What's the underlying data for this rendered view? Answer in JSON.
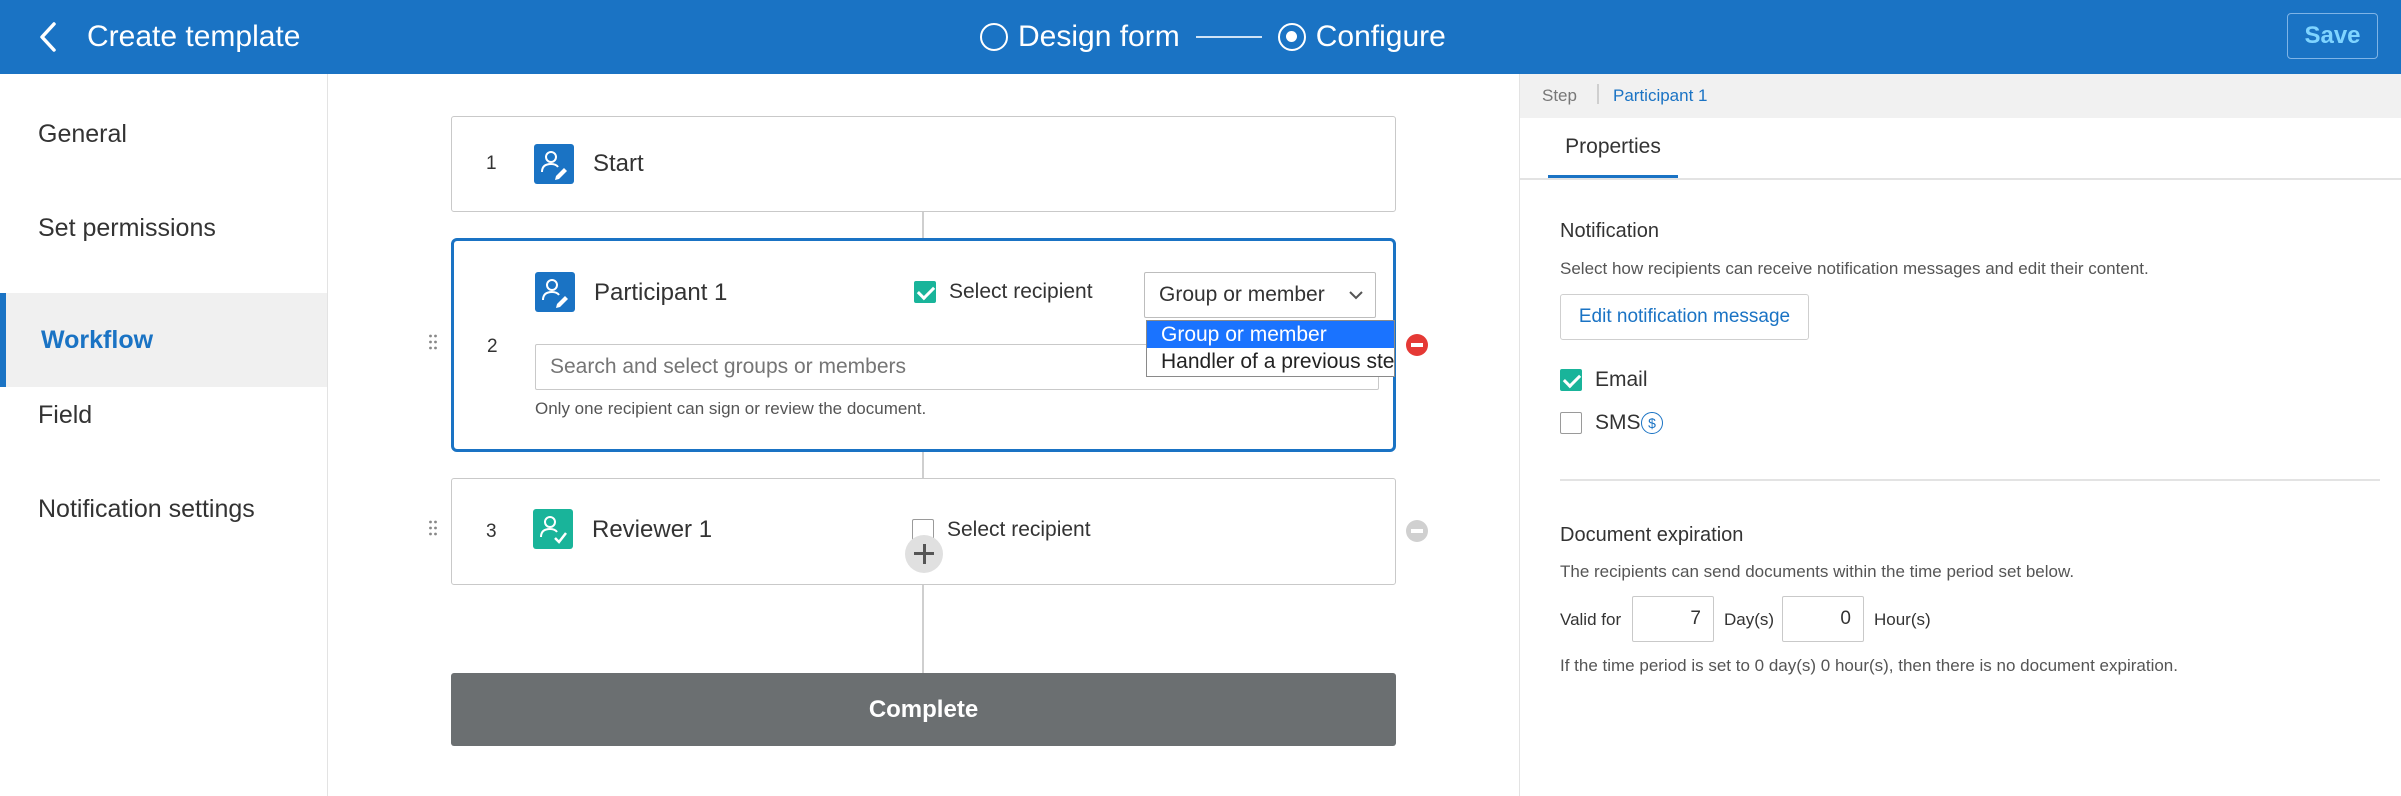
{
  "header": {
    "title": "Create template",
    "steps": [
      {
        "label": "Design form",
        "active": false
      },
      {
        "label": "Configure",
        "active": true
      }
    ],
    "save_label": "Save"
  },
  "sidebar": {
    "items": [
      {
        "label": "General",
        "active": false
      },
      {
        "label": "Set permissions",
        "active": false
      },
      {
        "label": "Workflow",
        "active": true
      },
      {
        "label": "Field",
        "active": false
      },
      {
        "label": "Notification settings",
        "active": false
      }
    ]
  },
  "workflow": {
    "steps": [
      {
        "number": "1",
        "name": "Start",
        "icon": "user-edit-icon"
      },
      {
        "number": "2",
        "name": "Participant 1",
        "icon": "user-edit-icon",
        "select_recipient_label": "Select recipient",
        "select_recipient_checked": true,
        "recipient_type": "Group or member",
        "search_placeholder": "Search and select groups or members",
        "help": "Only one recipient can sign or review the document."
      },
      {
        "number": "3",
        "name": "Reviewer 1",
        "icon": "user-check-icon",
        "select_recipient_label": "Select recipient",
        "select_recipient_checked": false
      }
    ],
    "dropdown_options": [
      "Group or member",
      "Handler of a previous step"
    ],
    "complete_label": "Complete",
    "colors": {
      "accent": "#1a73c4",
      "teal": "#19b49a",
      "remove": "#e53935"
    }
  },
  "panel": {
    "breadcrumb_step": "Step",
    "breadcrumb_current": "Participant 1",
    "tab": "Properties",
    "notification": {
      "heading": "Notification",
      "description": "Select how recipients can receive notification messages and edit their content.",
      "edit_button": "Edit notification message",
      "email_label": "Email",
      "email_checked": true,
      "sms_label": "SMS",
      "sms_checked": false
    },
    "expiration": {
      "heading": "Document expiration",
      "description": "The recipients can send documents within the time period set below.",
      "valid_for_label": "Valid for",
      "days_value": "7",
      "days_unit": "Day(s)",
      "hours_value": "0",
      "hours_unit": "Hour(s)",
      "note": "If the time period is set to 0 day(s) 0 hour(s), then there is no document expiration."
    }
  }
}
